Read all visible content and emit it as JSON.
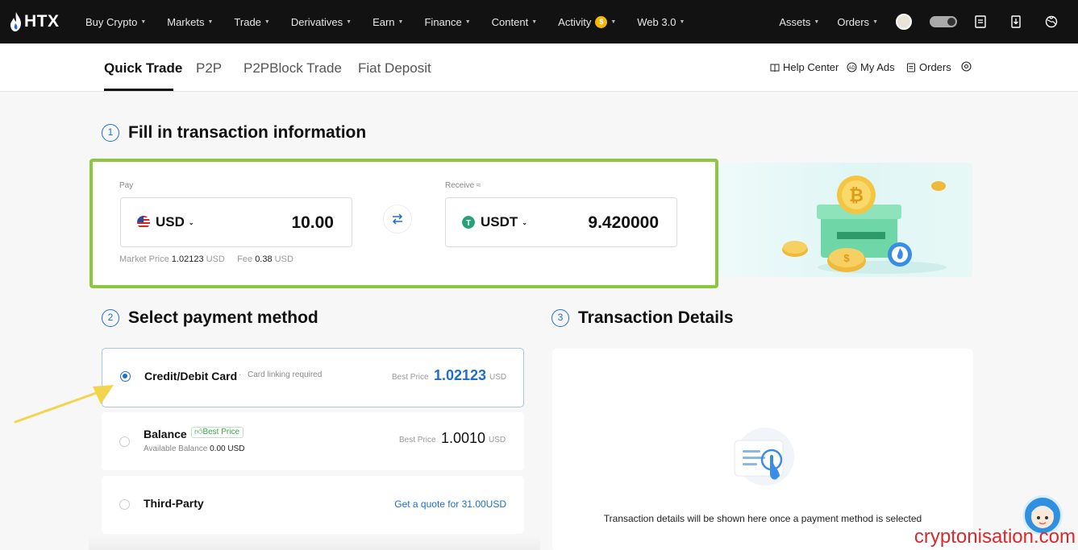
{
  "topnav": {
    "logo": "HTX",
    "items": [
      {
        "label": "Buy Crypto"
      },
      {
        "label": "Markets"
      },
      {
        "label": "Trade"
      },
      {
        "label": "Derivatives"
      },
      {
        "label": "Earn"
      },
      {
        "label": "Finance"
      },
      {
        "label": "Content"
      },
      {
        "label": "Activity"
      },
      {
        "label": "Web 3.0"
      }
    ],
    "activity_badge": "$",
    "right": {
      "assets": "Assets",
      "orders": "Orders"
    }
  },
  "subnav": {
    "tabs": [
      "Quick Trade",
      "P2P",
      "P2PBlock Trade",
      "Fiat Deposit"
    ],
    "active_tab": "Quick Trade",
    "links": {
      "help_center": "Help Center",
      "my_ads": "My Ads",
      "orders": "Orders"
    }
  },
  "step1": {
    "number": "1",
    "title": "Fill in transaction information",
    "pay": {
      "label": "Pay",
      "currency": "USD",
      "amount": "10.00",
      "market_price_label": "Market Price",
      "market_price": "1.02123",
      "market_price_unit": "USD",
      "fee_label": "Fee",
      "fee": "0.38",
      "fee_unit": "USD"
    },
    "receive": {
      "label": "Receive ≈",
      "currency": "USDT",
      "amount": "9.420000"
    }
  },
  "step2": {
    "number": "2",
    "title": "Select payment method",
    "methods": [
      {
        "name": "Credit/Debit Card",
        "separator": "·",
        "note": "Card linking required",
        "price_label": "Best Price",
        "price": "1.02123",
        "unit": "USD",
        "selected": true
      },
      {
        "name": "Balance",
        "badge": "Best Price",
        "balance_label": "Available Balance",
        "balance": "0.00 USD",
        "price_label": "Best Price",
        "price": "1.0010",
        "unit": "USD",
        "selected": false
      },
      {
        "name": "Third-Party",
        "link": "Get a quote for 31.00USD",
        "selected": false
      }
    ]
  },
  "step3": {
    "number": "3",
    "title": "Transaction Details",
    "placeholder": "Transaction details will be shown here once a payment method is selected"
  },
  "watermark": "cryptonisation.com",
  "colors": {
    "accent_blue": "#1f6fc7",
    "highlight_green": "#8dc63f",
    "annotation_arrow": "#f2d44e",
    "nav_bg": "#121212"
  }
}
